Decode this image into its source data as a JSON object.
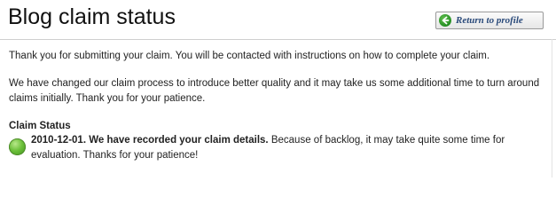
{
  "header": {
    "title": "Blog claim status",
    "return_button": {
      "label": "Return to profile",
      "icon": "back-arrow-icon"
    }
  },
  "content": {
    "paragraphs": [
      "Thank you for submitting your claim. You will be contacted with instructions on how to complete your claim.",
      "We have changed our claim process to introduce better quality and it may take us some additional time to turn around claims initially. Thank you for your patience."
    ],
    "claim_status": {
      "heading": "Claim Status",
      "date": "2010-12-01.",
      "bold_text": "We have recorded your claim details.",
      "text": "Because of backlog, it may take quite some time for evaluation. Thanks for your patience!",
      "indicator_color": "#5cb82e"
    }
  }
}
